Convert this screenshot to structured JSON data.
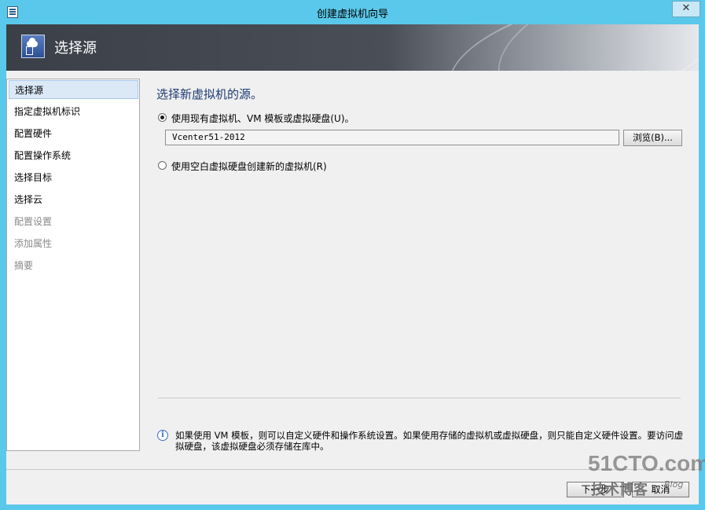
{
  "window": {
    "title": "创建虚拟机向导",
    "close_glyph": "✕"
  },
  "header": {
    "title": "选择源"
  },
  "nav": {
    "items": [
      {
        "label": "选择源",
        "state": "selected"
      },
      {
        "label": "指定虚拟机标识",
        "state": "normal"
      },
      {
        "label": "配置硬件",
        "state": "normal"
      },
      {
        "label": "配置操作系统",
        "state": "normal"
      },
      {
        "label": "选择目标",
        "state": "normal"
      },
      {
        "label": "选择云",
        "state": "normal"
      },
      {
        "label": "配置设置",
        "state": "disabled"
      },
      {
        "label": "添加属性",
        "state": "disabled"
      },
      {
        "label": "摘要",
        "state": "disabled"
      }
    ]
  },
  "main": {
    "heading": "选择新虚拟机的源。",
    "option_existing": {
      "label": "使用现有虚拟机、VM 模板或虚拟硬盘(U)。",
      "checked": true
    },
    "source_value": "Vcenter51-2012",
    "browse_label": "浏览(B)...",
    "option_blank": {
      "label": "使用空白虚拟硬盘创建新的虚拟机(R)",
      "checked": false
    },
    "info_text": "如果使用 VM 模板，则可以自定义硬件和操作系统设置。如果使用存储的虚拟机或虚拟硬盘，则只能自定义硬件设置。要访问虚拟硬盘，该虚拟硬盘必须存储在库中。"
  },
  "footer": {
    "next_label": "下一步",
    "cancel_label": "取消"
  },
  "watermark": {
    "main": "51CTO.com",
    "sub": "技术博客",
    "blog": "Blog"
  },
  "colors": {
    "window_frame": "#5ac8ea",
    "heading_text": "#1e3a73",
    "nav_selected": "#dbe9f7"
  }
}
